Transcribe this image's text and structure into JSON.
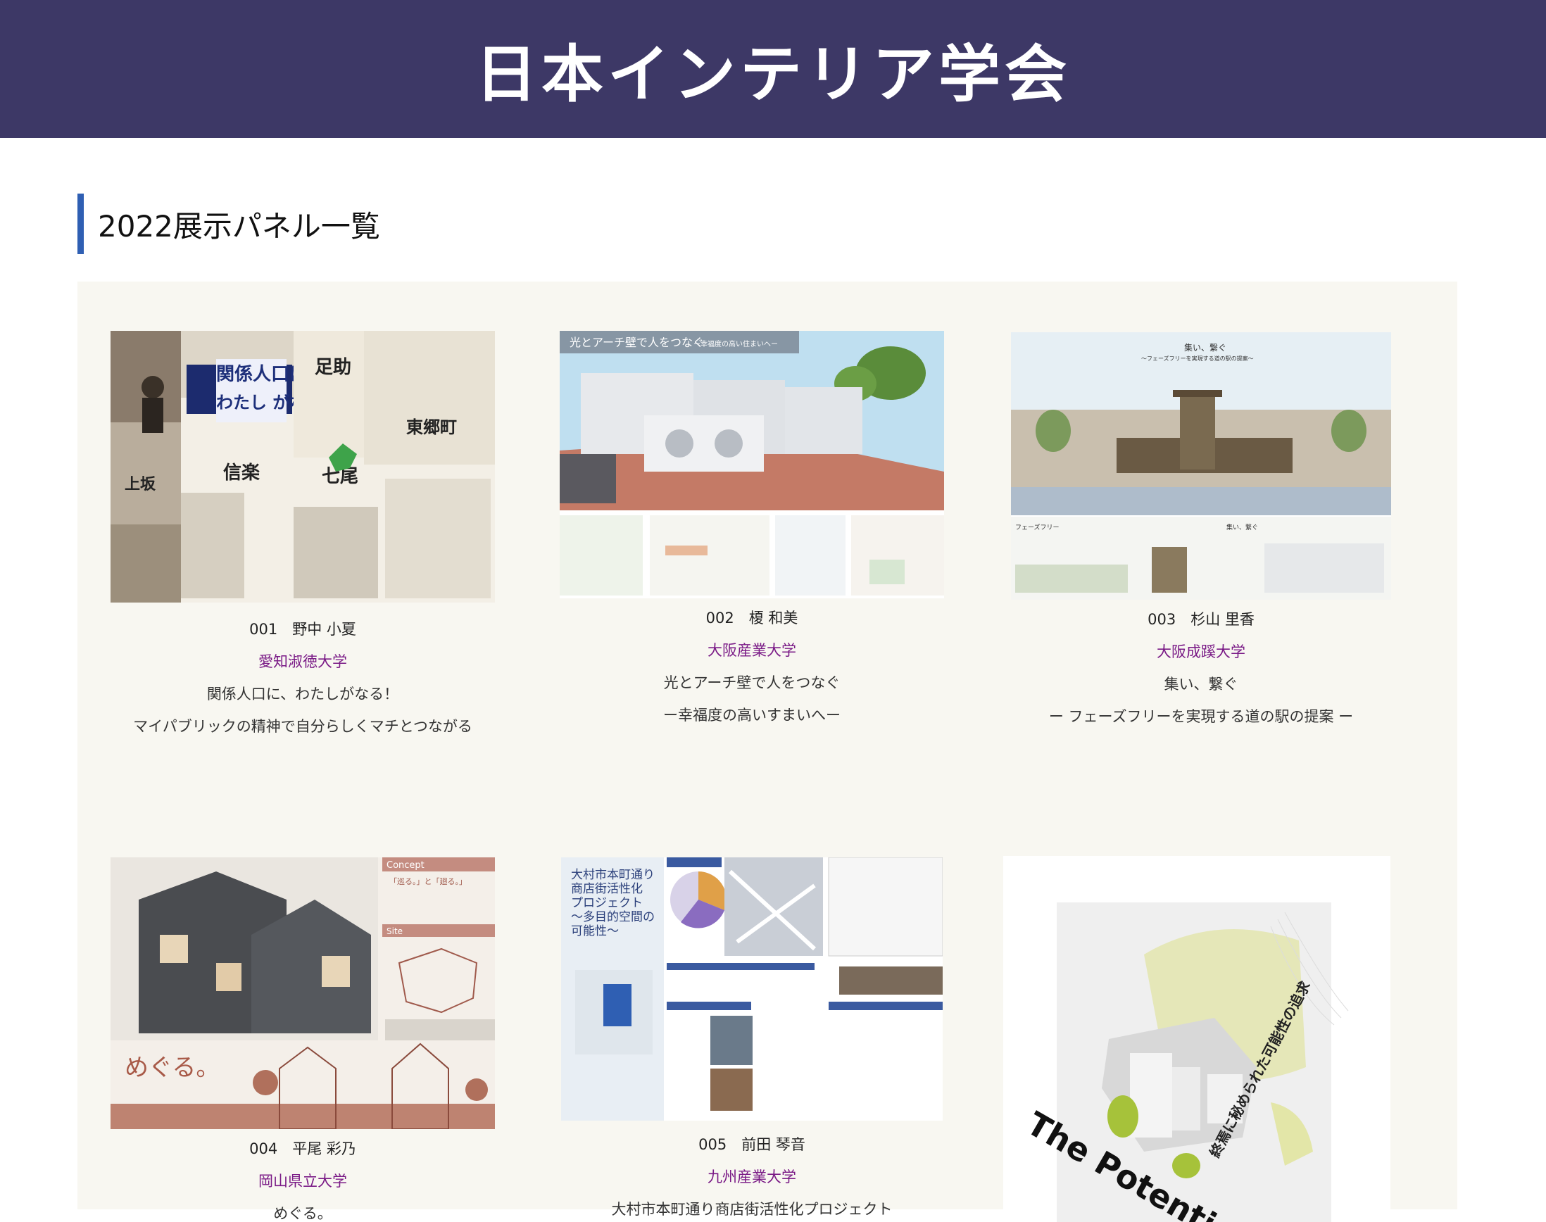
{
  "site": {
    "title": "日本インテリア学会"
  },
  "section": {
    "title": "2022展示パネル一覧"
  },
  "colors": {
    "header_bg": "#3d3866",
    "accent_bar": "#2f5fb3",
    "university_link": "#7a1a86",
    "gallery_bg": "#f8f7f1"
  },
  "panels": [
    {
      "id_name": "001　野中 小夏",
      "university": "愛知淑徳大学",
      "title": "関係人口に、わたしがなる！",
      "subtitle": "マイパブリックの精神で自分らしくマチとつながる",
      "thumb_text": [
        "関係人口に、",
        "わたし がなる！",
        "足助",
        "上坂",
        "信楽",
        "七尾",
        "東郷町"
      ]
    },
    {
      "id_name": "002　榎 和美",
      "university": "大阪産業大学",
      "title": "光とアーチ壁で人をつなぐ",
      "subtitle": "ー幸福度の高いすまいへー",
      "thumb_text": [
        "光とアーチ壁で人をつなぐ",
        "ー幸福度の高い住まいへー"
      ]
    },
    {
      "id_name": "003　杉山 里香",
      "university": "大阪成蹊大学",
      "title": "集い、繋ぐ",
      "subtitle": "ー フェーズフリーを実現する道の駅の提案 ー",
      "thumb_text": [
        "集い、繋ぐ",
        "～フェーズフリーを実現する道の駅の提案～",
        "フェーズフリー",
        "集い、繋ぐ"
      ]
    },
    {
      "id_name": "004　平尾 彩乃",
      "university": "岡山県立大学",
      "title": "めぐる。",
      "subtitle": "",
      "thumb_text": [
        "Concept",
        "「巡る。」と「廻る。」",
        "Site",
        "めぐる。"
      ]
    },
    {
      "id_name": "005　前田 琴音",
      "university": "九州産業大学",
      "title": "大村市本町通り商店街活性化プロジェクト",
      "subtitle": "",
      "thumb_text": [
        "大村市本町通り",
        "商店街活性化",
        "プロジェクト",
        "～多目的空間の",
        "可能性～"
      ]
    },
    {
      "id_name": "",
      "university": "",
      "title": "",
      "subtitle": "",
      "thumb_text": [
        "The Potential O",
        "終焉に秘められた可能性の追求"
      ]
    }
  ]
}
